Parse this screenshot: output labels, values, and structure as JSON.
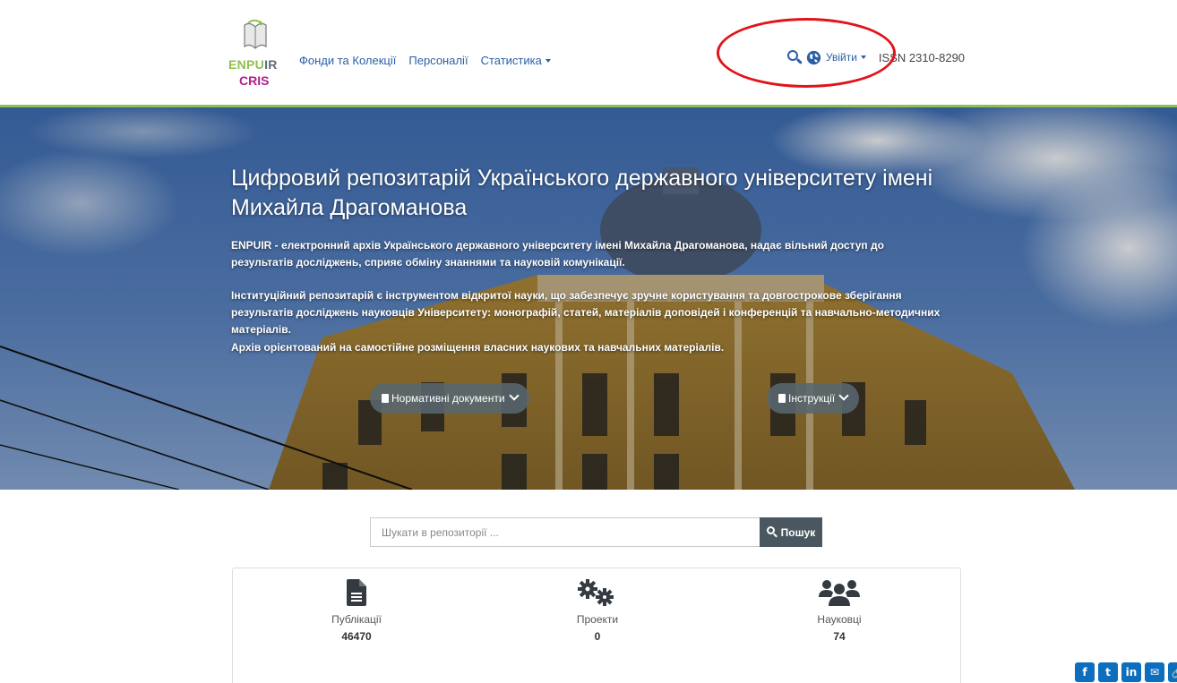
{
  "header": {
    "logo": {
      "line1_a": "ENPU",
      "line1_b": "IR",
      "line2": "CRIS"
    },
    "nav": [
      {
        "label": "Фонди та Колекції"
      },
      {
        "label": "Персоналії"
      },
      {
        "label": "Статистика",
        "has_dropdown": true
      }
    ],
    "login_label": "Увійти",
    "issn": "ISSN 2310-8290",
    "search_icon": "search-icon",
    "language_icon": "globe-icon"
  },
  "hero": {
    "title": "Цифровий репозитарій Українського державного університету імені Михайла Драгоманова",
    "paragraphs": [
      "ENPUIR - електронний архів Українського державного університету імені Михайла Драгоманова, надає вільний доступ до результатів досліджень, сприяє обміну знаннями та науковій комунікації.",
      "Інституційний репозитарій є інструментом відкритої науки, що забезпечує зручне користування та довгострокове зберігання результатів досліджень науковців Університету: монографій, статей, матеріалів доповідей і конференцій та навчально-методичних матеріалів.",
      "Архів орієнтований на самостійне розміщення власних наукових та навчальних матеріалів."
    ],
    "buttons": [
      {
        "label": "Нормативні документи",
        "icon": "file-icon"
      },
      {
        "label": "Інструкції",
        "icon": "book-icon"
      }
    ]
  },
  "search": {
    "placeholder": "Шукати в репозиторії ...",
    "button_label": "Пошук"
  },
  "stats": [
    {
      "label": "Публікації",
      "value": "46470",
      "icon": "document-icon"
    },
    {
      "label": "Проекти",
      "value": "0",
      "icon": "gears-icon"
    },
    {
      "label": "Науковці",
      "value": "74",
      "icon": "users-icon"
    }
  ],
  "share": [
    {
      "name": "facebook",
      "glyph": "f",
      "color": "#0d6ebd"
    },
    {
      "name": "twitter",
      "glyph": "t",
      "color": "#0d6ebd"
    },
    {
      "name": "linkedin",
      "glyph": "in",
      "color": "#0d6ebd"
    },
    {
      "name": "email",
      "glyph": "✉",
      "color": "#0d6ebd"
    },
    {
      "name": "copy-link",
      "glyph": "🔗",
      "color": "#0d6ebd"
    },
    {
      "name": "more",
      "glyph": "+",
      "color": "#0d6ebd"
    }
  ],
  "colors": {
    "link": "#2a5fa7",
    "accent_green": "#8dc153",
    "annotation_red": "#e2141a",
    "button_dark": "#4a5760"
  }
}
